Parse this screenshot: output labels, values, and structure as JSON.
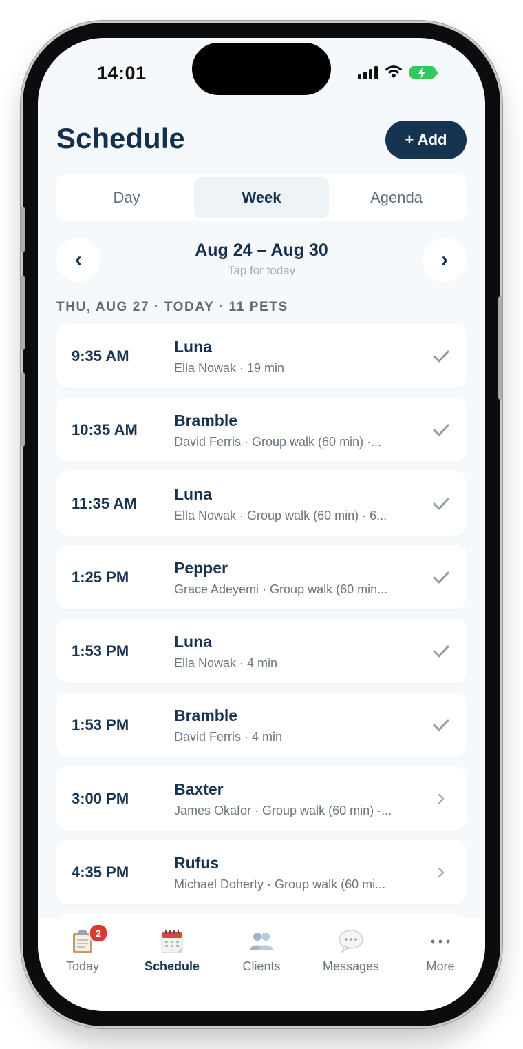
{
  "status": {
    "time": "14:01"
  },
  "header": {
    "title": "Schedule",
    "add_label": "+ Add"
  },
  "tabs": [
    "Day",
    "Week",
    "Agenda"
  ],
  "active_tab": "Week",
  "range": {
    "title": "Aug 24 – Aug 30",
    "subtitle": "Tap for today",
    "prev_label": "‹",
    "next_label": "›"
  },
  "section": {
    "label": "THU, AUG 27 · TODAY · 11 PETS"
  },
  "appointments": [
    {
      "time": "9:35 AM",
      "pet": "Luna",
      "detail": "Ella Nowak · 19 min",
      "status": "done"
    },
    {
      "time": "10:35 AM",
      "pet": "Bramble",
      "detail": "David Ferris · Group walk (60 min) ·...",
      "status": "done"
    },
    {
      "time": "11:35 AM",
      "pet": "Luna",
      "detail": "Ella Nowak · Group walk (60 min) · 6...",
      "status": "done"
    },
    {
      "time": "1:25 PM",
      "pet": "Pepper",
      "detail": "Grace Adeyemi · Group walk (60 min...",
      "status": "done"
    },
    {
      "time": "1:53 PM",
      "pet": "Luna",
      "detail": "Ella Nowak · 4 min",
      "status": "done"
    },
    {
      "time": "1:53 PM",
      "pet": "Bramble",
      "detail": "David Ferris · 4 min",
      "status": "done"
    },
    {
      "time": "3:00 PM",
      "pet": "Baxter",
      "detail": "James Okafor · Group walk (60 min) ·...",
      "status": "upcoming"
    },
    {
      "time": "4:35 PM",
      "pet": "Rufus",
      "detail": "Michael Doherty · Group walk (60 mi...",
      "status": "upcoming"
    }
  ],
  "tabbar": {
    "items": [
      {
        "label": "Today",
        "icon": "clipboard-icon",
        "badge": "2"
      },
      {
        "label": "Schedule",
        "icon": "calendar-icon",
        "active": true
      },
      {
        "label": "Clients",
        "icon": "people-icon"
      },
      {
        "label": "Messages",
        "icon": "speech-bubble-icon"
      },
      {
        "label": "More",
        "icon": "more-dots-icon"
      }
    ]
  },
  "colors": {
    "navy": "#16334f",
    "background": "#f5f9fc",
    "badge": "#d63c32",
    "check": "#8e9ba6"
  }
}
